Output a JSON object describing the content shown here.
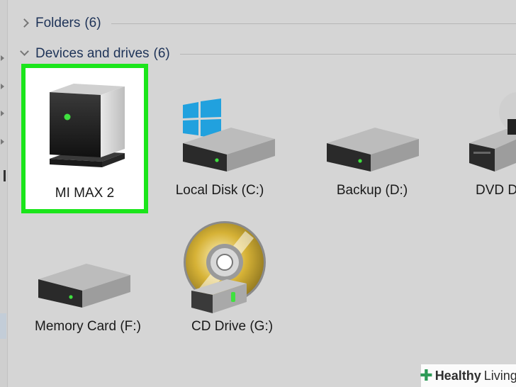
{
  "sections": {
    "folders": {
      "title": "Folders",
      "count": "(6)",
      "expanded": false
    },
    "devices": {
      "title": "Devices and drives",
      "count": "(6)",
      "expanded": true
    }
  },
  "drives": [
    {
      "label": "MI MAX 2",
      "icon": "phone-device-icon",
      "selected": true
    },
    {
      "label": "Local Disk (C:)",
      "icon": "windows-hard-drive-icon"
    },
    {
      "label": "Backup (D:)",
      "icon": "hard-drive-icon"
    },
    {
      "label": "DVD D",
      "icon": "dvd-drive-icon"
    },
    {
      "label": "Memory Card (F:)",
      "icon": "hard-drive-icon"
    },
    {
      "label": "CD Drive (G:)",
      "icon": "cd-drive-icon"
    }
  ],
  "watermark": {
    "brand": "Healthy",
    "sub": "Living"
  },
  "colors": {
    "highlight": "#1be51b",
    "background": "#d5d5d5",
    "led": "#3fe03f"
  }
}
